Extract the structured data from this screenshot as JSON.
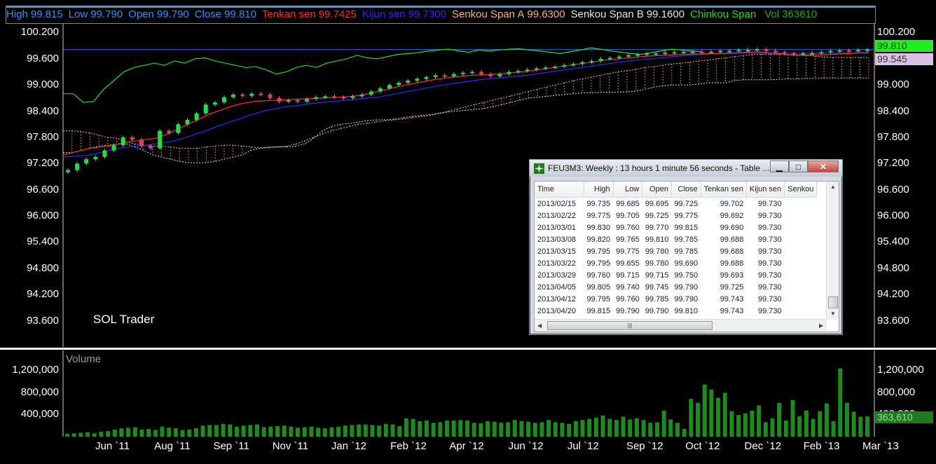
{
  "legend": [
    {
      "label": "High",
      "value": "99.815",
      "color": "#3a8dff"
    },
    {
      "label": "Low",
      "value": "99.790",
      "color": "#3a8dff"
    },
    {
      "label": "Open",
      "value": "99.790",
      "color": "#3a8dff"
    },
    {
      "label": "Close",
      "value": "99.810",
      "color": "#3a8dff"
    },
    {
      "label": "Tenkan sen",
      "value": "99.7425",
      "color": "#ff2a2a"
    },
    {
      "label": "Kijun sen",
      "value": "99.7300",
      "color": "#2a2aff"
    },
    {
      "label": "Senkou Span A",
      "value": "99.6300",
      "color": "#ffb07a"
    },
    {
      "label": "Senkou Span B",
      "value": "99.1600",
      "color": "#e6e6e6"
    },
    {
      "label": "Chinkou Span",
      "value": "",
      "color": "#22dd22"
    },
    {
      "label": "Vol",
      "value": "363610",
      "color": "#22aa22"
    }
  ],
  "price_axis": {
    "ticks": [
      "100.200",
      "99.600",
      "99.000",
      "98.400",
      "97.800",
      "97.200",
      "96.600",
      "96.000",
      "95.400",
      "94.800",
      "94.200",
      "93.600"
    ],
    "min": 93.0,
    "max": 100.4
  },
  "price_tags": {
    "last": "99.810",
    "last_color": "#22ee22",
    "senkou_b": "99.545",
    "senkou_b_color": "#d9c2e6"
  },
  "volume_panel": {
    "title": "Volume",
    "ticks": [
      "1,200,000",
      "800,000",
      "400,000"
    ],
    "last": "363,610"
  },
  "watermark": "SOL Trader",
  "x_axis_labels": [
    "Jun `11",
    "Aug `11",
    "Sep `11",
    "Nov `11",
    "Jan `12",
    "Feb `12",
    "Apr `12",
    "Jun `12",
    "Jul `12",
    "Sep `12",
    "Oct `12",
    "Dec `12",
    "Feb `13",
    "Mar `13"
  ],
  "data_window": {
    "caption": "FEU3M3: Weekly : 13 hours 1 minute 56 seconds - Table ...",
    "buttons": {
      "minimize": "▁",
      "maximize": "□",
      "close": "✕"
    },
    "columns": [
      "Time",
      "High",
      "Low",
      "Open",
      "Close",
      "Tenkan sen",
      "Kijun sen",
      "Senkou"
    ],
    "rows": [
      [
        "2013/02/15",
        "99.735",
        "99.685",
        "99.695",
        "99.725",
        "99.702",
        "99.730"
      ],
      [
        "2013/02/22",
        "99.775",
        "99.705",
        "99.725",
        "99.775",
        "99.692",
        "99.730"
      ],
      [
        "2013/03/01",
        "99.830",
        "99.760",
        "99.770",
        "99.815",
        "99.690",
        "99.730"
      ],
      [
        "2013/03/08",
        "99.820",
        "99.765",
        "99.810",
        "99.785",
        "99.688",
        "99.730"
      ],
      [
        "2013/03/15",
        "99.795",
        "99.775",
        "99.780",
        "99.785",
        "99.688",
        "99.730"
      ],
      [
        "2013/03/22",
        "99.795",
        "99.655",
        "99.780",
        "99.690",
        "99.688",
        "99.730"
      ],
      [
        "2013/03/29",
        "99.760",
        "99.715",
        "99.715",
        "99.750",
        "99.693",
        "99.730"
      ],
      [
        "2013/04/05",
        "99.805",
        "99.740",
        "99.745",
        "99.790",
        "99.725",
        "99.730"
      ],
      [
        "2013/04/12",
        "99.795",
        "99.760",
        "99.785",
        "99.790",
        "99.743",
        "99.730"
      ],
      [
        "2013/04/20",
        "99.815",
        "99.790",
        "99.790",
        "99.810",
        "99.743",
        "99.730"
      ]
    ]
  },
  "chart_data": {
    "type": "candlestick",
    "instrument": "FEU3M3",
    "period": "Weekly",
    "price_range": [
      93.0,
      100.4
    ],
    "x_labels": [
      "Jun `11",
      "Aug `11",
      "Sep `11",
      "Nov `11",
      "Jan `12",
      "Feb `12",
      "Apr `12",
      "Jun `12",
      "Jul `12",
      "Sep `12",
      "Oct `12",
      "Dec `12",
      "Feb `13",
      "Mar `13"
    ],
    "close": [
      97.05,
      97.2,
      97.3,
      97.35,
      97.5,
      97.62,
      97.8,
      97.75,
      97.6,
      97.55,
      97.95,
      97.9,
      98.1,
      98.2,
      98.35,
      98.55,
      98.6,
      98.72,
      98.78,
      98.75,
      98.8,
      98.78,
      98.7,
      98.62,
      98.65,
      98.62,
      98.68,
      98.72,
      98.74,
      98.72,
      98.7,
      98.74,
      98.78,
      98.85,
      98.92,
      99.0,
      99.05,
      99.1,
      99.14,
      99.18,
      99.22,
      99.2,
      99.25,
      99.28,
      99.3,
      99.25,
      99.2,
      99.25,
      99.3,
      99.32,
      99.35,
      99.38,
      99.4,
      99.42,
      99.45,
      99.48,
      99.52,
      99.55,
      99.6,
      99.62,
      99.65,
      99.68,
      99.7,
      99.72,
      99.72,
      99.74,
      99.75,
      99.76,
      99.76,
      99.75,
      99.76,
      99.78,
      99.78,
      99.8,
      99.8,
      99.82,
      99.78,
      99.75,
      99.72,
      99.7,
      99.72,
      99.73,
      99.75,
      99.78,
      99.79,
      99.78,
      99.8,
      99.81
    ],
    "open": [
      97.0,
      97.05,
      97.2,
      97.3,
      97.35,
      97.5,
      97.62,
      97.8,
      97.75,
      97.6,
      97.55,
      97.95,
      97.9,
      98.1,
      98.2,
      98.35,
      98.55,
      98.6,
      98.72,
      98.78,
      98.75,
      98.8,
      98.78,
      98.7,
      98.62,
      98.65,
      98.62,
      98.68,
      98.72,
      98.74,
      98.72,
      98.7,
      98.74,
      98.78,
      98.85,
      98.92,
      99.0,
      99.05,
      99.1,
      99.14,
      99.18,
      99.22,
      99.2,
      99.25,
      99.28,
      99.3,
      99.25,
      99.2,
      99.25,
      99.3,
      99.32,
      99.35,
      99.38,
      99.4,
      99.42,
      99.45,
      99.48,
      99.52,
      99.55,
      99.6,
      99.62,
      99.65,
      99.68,
      99.7,
      99.72,
      99.72,
      99.74,
      99.75,
      99.76,
      99.76,
      99.75,
      99.76,
      99.78,
      99.78,
      99.8,
      99.8,
      99.82,
      99.78,
      99.75,
      99.72,
      99.7,
      99.72,
      99.73,
      99.75,
      99.78,
      99.79,
      99.78,
      99.79
    ],
    "tenkan": [
      97.4,
      97.45,
      97.5,
      97.55,
      97.58,
      97.6,
      97.65,
      97.7,
      97.72,
      97.75,
      97.78,
      97.85,
      97.95,
      98.05,
      98.15,
      98.25,
      98.35,
      98.42,
      98.5,
      98.56,
      98.6,
      98.63,
      98.64,
      98.65,
      98.66,
      98.67,
      98.68,
      98.69,
      98.7,
      98.71,
      98.72,
      98.74,
      98.76,
      98.8,
      98.85,
      98.9,
      98.95,
      99.0,
      99.04,
      99.08,
      99.12,
      99.15,
      99.18,
      99.2,
      99.22,
      99.23,
      99.24,
      99.25,
      99.27,
      99.29,
      99.31,
      99.34,
      99.37,
      99.4,
      99.43,
      99.46,
      99.49,
      99.52,
      99.55,
      99.58,
      99.6,
      99.62,
      99.64,
      99.66,
      99.67,
      99.68,
      99.69,
      99.7,
      99.71,
      99.71,
      99.72,
      99.72,
      99.73,
      99.74,
      99.75,
      99.76,
      99.74,
      99.72,
      99.7,
      99.69,
      99.69,
      99.69,
      99.69,
      99.7,
      99.71,
      99.72,
      99.74,
      99.74
    ],
    "kijun": [
      97.35,
      97.36,
      97.38,
      97.4,
      97.45,
      97.5,
      97.55,
      97.58,
      97.6,
      97.62,
      97.65,
      97.68,
      97.72,
      97.78,
      97.85,
      97.92,
      98.0,
      98.08,
      98.15,
      98.22,
      98.3,
      98.36,
      98.42,
      98.46,
      98.5,
      98.52,
      98.55,
      98.58,
      98.6,
      98.62,
      98.64,
      98.66,
      98.68,
      98.7,
      98.72,
      98.76,
      98.8,
      98.84,
      98.88,
      98.92,
      98.96,
      99.0,
      99.03,
      99.06,
      99.09,
      99.12,
      99.14,
      99.16,
      99.18,
      99.2,
      99.22,
      99.25,
      99.28,
      99.31,
      99.34,
      99.37,
      99.4,
      99.43,
      99.46,
      99.49,
      99.52,
      99.55,
      99.57,
      99.59,
      99.61,
      99.63,
      99.65,
      99.67,
      99.69,
      99.7,
      99.71,
      99.72,
      99.72,
      99.73,
      99.73,
      99.73,
      99.73,
      99.73,
      99.73,
      99.73,
      99.73,
      99.73,
      99.73,
      99.73,
      99.73,
      99.73,
      99.73,
      99.73
    ],
    "chinkou": [
      98.8,
      98.8,
      98.6,
      98.62,
      98.9,
      99.1,
      99.3,
      99.4,
      99.45,
      99.5,
      99.45,
      99.55,
      99.5,
      99.6,
      99.62,
      99.55,
      99.5,
      99.45,
      99.4,
      99.42,
      99.35,
      99.25,
      99.3,
      99.4,
      99.45,
      99.4,
      99.5,
      99.55,
      99.6,
      99.68,
      99.62,
      99.6,
      99.65,
      99.7,
      99.72,
      99.74,
      99.78,
      99.8,
      99.82,
      99.78,
      99.75,
      99.8,
      99.78,
      99.8,
      99.82,
      99.83,
      99.8,
      99.78,
      99.75,
      99.72,
      99.76,
      99.8,
      99.85,
      99.82,
      99.78,
      99.75,
      99.72,
      99.7,
      99.74,
      99.78,
      99.82,
      99.8,
      99.78,
      99.76
    ],
    "senkou_a": [
      97.95,
      97.95,
      97.93,
      97.9,
      97.85,
      97.8,
      97.78,
      97.7,
      97.65,
      97.62,
      97.6,
      97.6,
      97.58,
      97.55,
      97.55,
      97.55,
      97.58,
      97.6,
      97.62,
      97.62,
      97.6,
      97.58,
      97.56,
      97.56,
      97.58,
      97.6,
      97.65,
      97.72,
      97.8,
      97.88,
      97.95,
      98.0,
      98.05,
      98.1,
      98.12,
      98.15,
      98.18,
      98.2,
      98.22,
      98.25,
      98.28,
      98.3,
      98.35,
      98.4,
      98.45,
      98.5,
      98.55,
      98.6,
      98.65,
      98.7,
      98.75,
      98.8,
      98.85,
      98.9,
      98.95,
      99.0,
      99.05,
      99.1,
      99.14,
      99.18,
      99.22,
      99.26,
      99.3,
      99.33,
      99.36,
      99.4,
      99.42,
      99.45,
      99.48,
      99.5,
      99.52,
      99.55,
      99.57,
      99.6,
      99.62,
      99.65,
      99.67,
      99.7,
      99.7,
      99.7,
      99.7,
      99.69,
      99.68,
      99.68,
      99.66,
      99.64,
      99.63,
      99.63,
      99.63,
      99.63,
      99.63
    ],
    "senkou_b": [
      97.45,
      97.45,
      97.5,
      97.55,
      97.6,
      97.62,
      97.64,
      97.66,
      97.58,
      97.5,
      97.4,
      97.35,
      97.3,
      97.25,
      97.22,
      97.22,
      97.22,
      97.25,
      97.3,
      97.35,
      97.4,
      97.5,
      97.55,
      97.58,
      97.58,
      97.58,
      97.6,
      97.65,
      97.78,
      97.95,
      98.05,
      98.1,
      98.12,
      98.15,
      98.18,
      98.2,
      98.2,
      98.22,
      98.25,
      98.28,
      98.3,
      98.32,
      98.35,
      98.38,
      98.4,
      98.42,
      98.44,
      98.46,
      98.5,
      98.55,
      98.6,
      98.65,
      98.7,
      98.72,
      98.74,
      98.76,
      98.78,
      98.8,
      98.82,
      98.82,
      98.83,
      98.83,
      98.84,
      98.84,
      98.86,
      98.9,
      98.95,
      98.98,
      99.0,
      99.0,
      99.0,
      99.02,
      99.05,
      99.05,
      99.05,
      99.1,
      99.12,
      99.12,
      99.12,
      99.12,
      99.13,
      99.14,
      99.14,
      99.15,
      99.15,
      99.16,
      99.16,
      99.16,
      99.16,
      99.16,
      99.16
    ],
    "volume": [
      50000,
      60000,
      70000,
      80000,
      60000,
      90000,
      100000,
      130000,
      150000,
      160000,
      170000,
      130000,
      140000,
      120000,
      180000,
      160000,
      150000,
      120000,
      130000,
      150000,
      200000,
      210000,
      210000,
      230000,
      220000,
      180000,
      200000,
      210000,
      220000,
      170000,
      180000,
      190000,
      200000,
      180000,
      160000,
      170000,
      180000,
      160000,
      150000,
      170000,
      180000,
      200000,
      210000,
      220000,
      220000,
      210000,
      200000,
      230000,
      220000,
      190000,
      330000,
      320000,
      280000,
      290000,
      250000,
      260000,
      290000,
      290000,
      300000,
      290000,
      250000,
      240000,
      280000,
      270000,
      250000,
      260000,
      300000,
      280000,
      270000,
      250000,
      260000,
      300000,
      260000,
      250000,
      230000,
      280000,
      300000,
      320000,
      340000,
      380000,
      320000,
      300000,
      360000,
      310000,
      330000,
      300000,
      250000,
      260000,
      470000,
      310000,
      250000,
      140000,
      680000,
      610000,
      940000,
      850000,
      700000,
      790000,
      460000,
      390000,
      420000,
      470000,
      560000,
      260000,
      330000,
      610000,
      290000,
      660000,
      370000,
      470000,
      320000,
      460000,
      600000,
      280000,
      1230000,
      610000,
      450000,
      360000,
      363610
    ],
    "volume_range": [
      0,
      1300000
    ]
  }
}
